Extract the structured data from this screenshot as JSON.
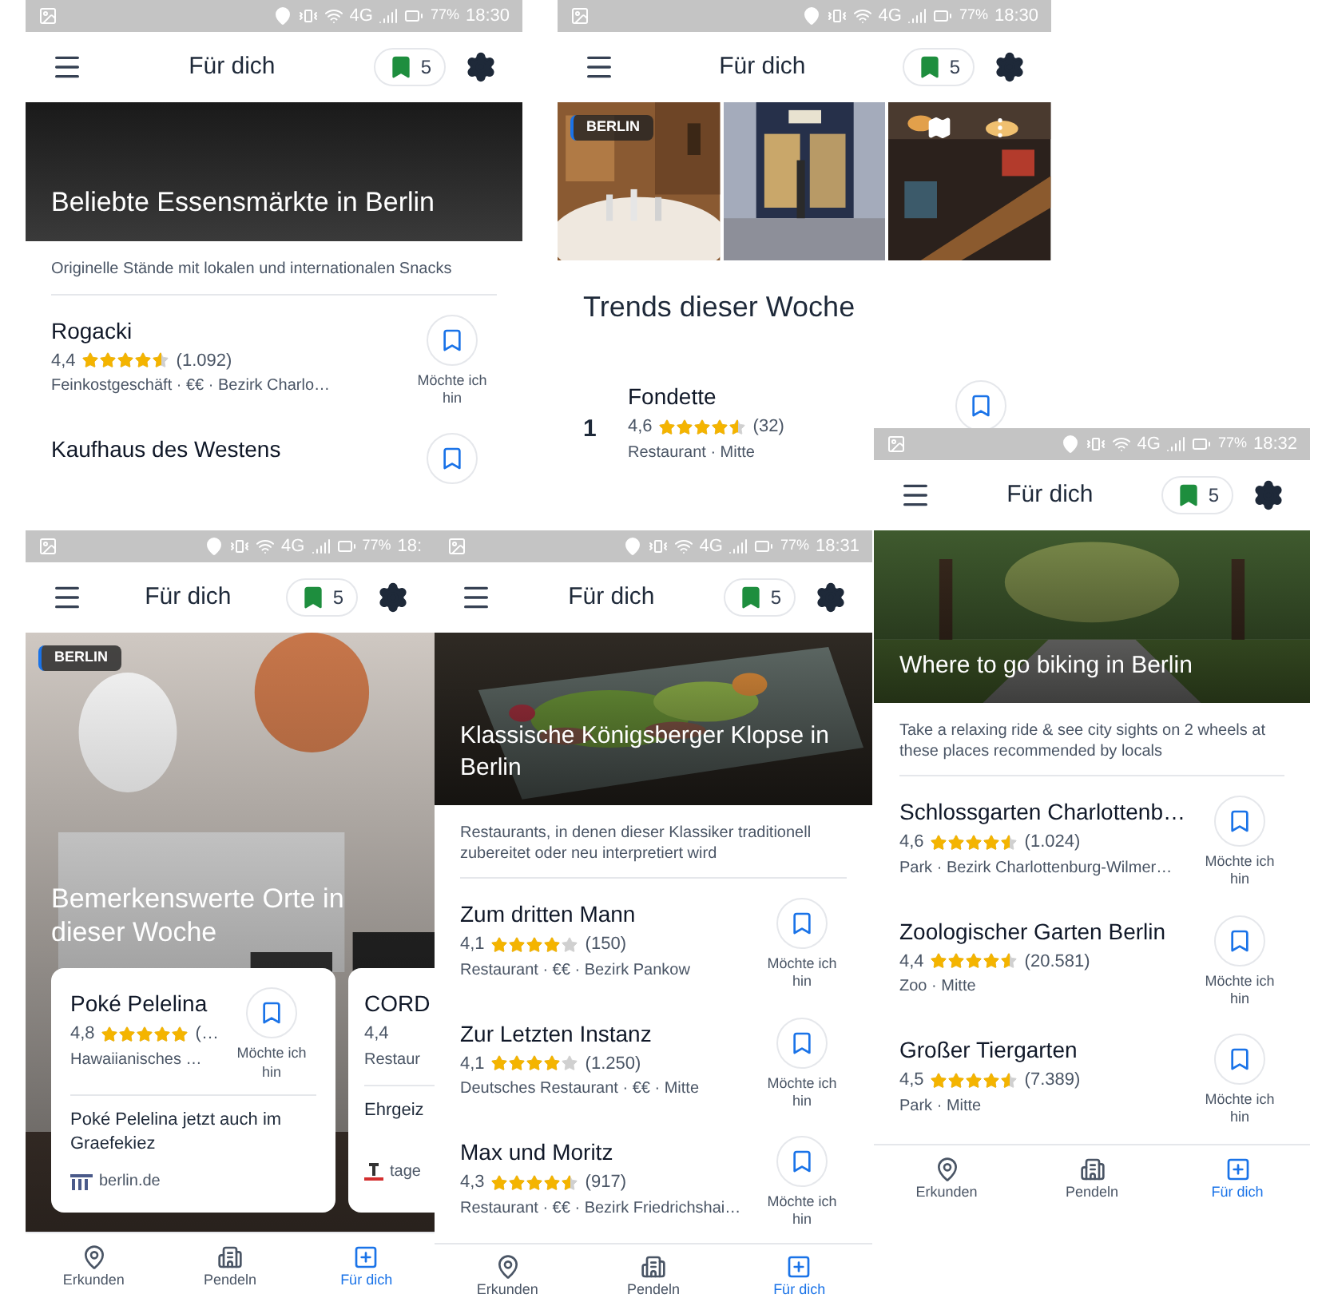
{
  "screens": [
    {
      "status": {
        "network": "4G",
        "battery": "77%",
        "time": "18:30"
      },
      "app_bar": {
        "title": "Für dich",
        "saved_count": "5"
      },
      "header": {
        "kind": "dark_banner",
        "title": "Beliebte Essensmärkte in Berlin"
      },
      "description": "Originelle Stände mit lokalen und internationalen Snacks",
      "places": [
        {
          "name": "Rogacki",
          "rating": "4,4",
          "stars": 4.5,
          "reviews": "(1.092)",
          "details": "Feinkostgeschäft · €€ · Bezirk Charlo…",
          "save_label": "Möchte ich hin"
        },
        {
          "name": "Kaufhaus des Westens"
        }
      ]
    },
    {
      "status": {
        "network": "4G",
        "battery": "77%",
        "time": "18:30"
      },
      "app_bar": {
        "title": "Für dich",
        "saved_count": "5"
      },
      "header": {
        "kind": "photo_strip",
        "tag": "BERLIN"
      },
      "section_title": "Trends dieser Woche",
      "places": [
        {
          "rank": "1",
          "name": "Fondette",
          "rating": "4,6",
          "stars": 4.5,
          "reviews": "(32)",
          "details": "Restaurant · Mitte"
        }
      ]
    },
    {
      "status": {
        "network": "4G",
        "battery": "77%",
        "time": "18:"
      },
      "app_bar": {
        "title": "Für dich",
        "saved_count": "5"
      },
      "header": {
        "kind": "photo_feature",
        "tag": "BERLIN",
        "title": "Bemerkenswerte Orte in dieser Woche"
      },
      "cards": [
        {
          "name": "Poké Pelelina",
          "rating": "4,8",
          "stars": 5,
          "reviews": "(…",
          "details": "Hawaiianisches …",
          "save_label": "Möchte ich hin",
          "news": "Poké Pelelina jetzt auch im Graefekiez",
          "source": "berlin.de"
        },
        {
          "name": "CORD",
          "rating": "4,4",
          "details": "Restaur",
          "news": "Ehrgeiz",
          "source": "tage"
        }
      ],
      "bottom_nav": [
        {
          "label": "Erkunden",
          "selected": false
        },
        {
          "label": "Pendeln",
          "selected": false
        },
        {
          "label": "Für dich",
          "selected": true
        }
      ]
    },
    {
      "status": {
        "network": "4G",
        "battery": "77%",
        "time": "18:31"
      },
      "app_bar": {
        "title": "Für dich",
        "saved_count": "5"
      },
      "header": {
        "kind": "photo_banner",
        "title": "Klassische Königsberger Klopse in Berlin"
      },
      "description": "Restaurants, in denen dieser Klassiker traditionell zubereitet oder neu interpretiert wird",
      "places": [
        {
          "name": "Zum dritten Mann",
          "rating": "4,1",
          "stars": 4,
          "reviews": "(150)",
          "details": "Restaurant · €€ · Bezirk Pankow",
          "save_label": "Möchte ich hin"
        },
        {
          "name": "Zur Letzten Instanz",
          "rating": "4,1",
          "stars": 4,
          "reviews": "(1.250)",
          "details": "Deutsches Restaurant · €€ · Mitte",
          "save_label": "Möchte ich hin"
        },
        {
          "name": "Max und Moritz",
          "rating": "4,3",
          "stars": 4.5,
          "reviews": "(917)",
          "details": "Restaurant · €€ · Bezirk Friedrichshai…",
          "save_label": "Möchte ich hin"
        }
      ],
      "bottom_nav": [
        {
          "label": "Erkunden",
          "selected": false
        },
        {
          "label": "Pendeln",
          "selected": false
        },
        {
          "label": "Für dich",
          "selected": true
        }
      ]
    },
    {
      "status": {
        "network": "4G",
        "battery": "77%",
        "time": "18:32"
      },
      "app_bar": {
        "title": "Für dich",
        "saved_count": "5"
      },
      "header": {
        "kind": "photo_banner",
        "title": "Where to go biking in Berlin"
      },
      "description": "Take a relaxing ride & see city sights on 2 wheels at these places recommended by locals",
      "places": [
        {
          "name": "Schlossgarten Charlottenb…",
          "rating": "4,6",
          "stars": 4.5,
          "reviews": "(1.024)",
          "details": "Park · Bezirk Charlottenburg-Wilmer…",
          "save_label": "Möchte ich hin"
        },
        {
          "name": "Zoologischer Garten Berlin",
          "rating": "4,4",
          "stars": 4.5,
          "reviews": "(20.581)",
          "details": "Zoo · Mitte",
          "save_label": "Möchte ich hin"
        },
        {
          "name": "Großer Tiergarten",
          "rating": "4,5",
          "stars": 4.5,
          "reviews": "(7.389)",
          "details": "Park · Mitte",
          "save_label": "Möchte ich hin"
        }
      ],
      "bottom_nav": [
        {
          "label": "Erkunden",
          "selected": false
        },
        {
          "label": "Pendeln",
          "selected": false
        },
        {
          "label": "Für dich",
          "selected": true
        }
      ]
    }
  ]
}
